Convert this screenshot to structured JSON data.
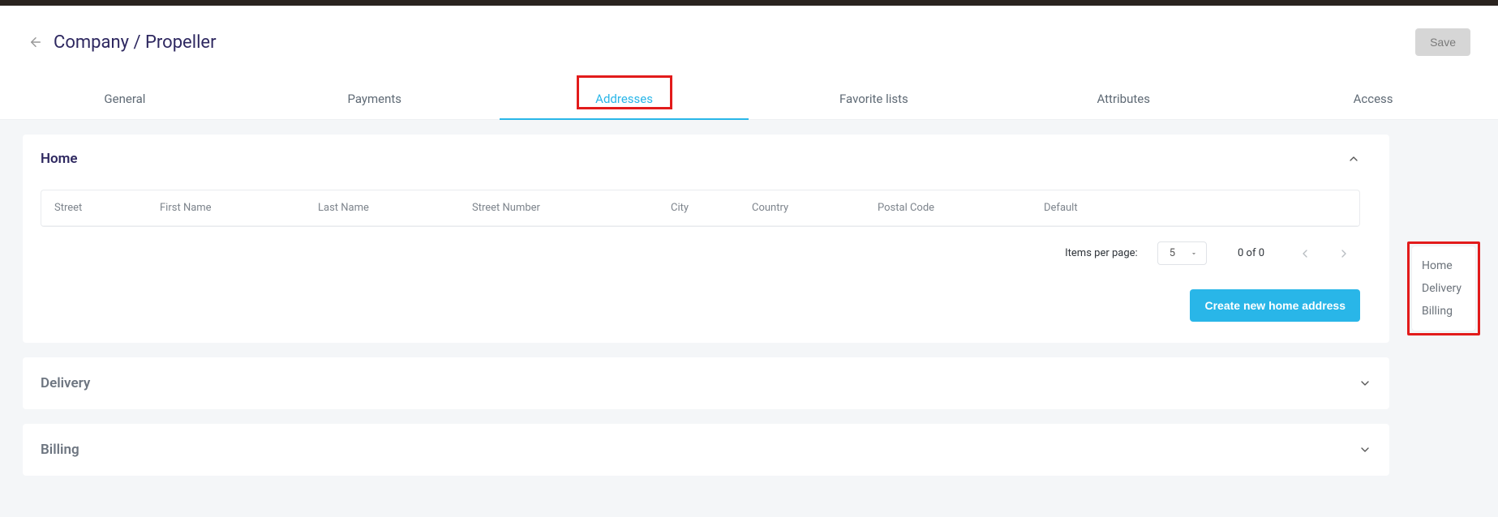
{
  "header": {
    "title": "Company / Propeller",
    "save_label": "Save"
  },
  "tabs": [
    {
      "label": "General"
    },
    {
      "label": "Payments"
    },
    {
      "label": "Addresses"
    },
    {
      "label": "Favorite lists"
    },
    {
      "label": "Attributes"
    },
    {
      "label": "Access"
    }
  ],
  "sideNav": {
    "items": [
      {
        "label": "Home"
      },
      {
        "label": "Delivery"
      },
      {
        "label": "Billing"
      }
    ]
  },
  "sections": {
    "home": {
      "title": "Home",
      "columns": {
        "street": "Street",
        "first_name": "First Name",
        "last_name": "Last Name",
        "street_number": "Street Number",
        "city": "City",
        "country": "Country",
        "postal_code": "Postal Code",
        "default": "Default"
      },
      "pagination": {
        "items_per_page_label": "Items per page:",
        "items_per_page_value": "5",
        "range_text": "0 of 0"
      },
      "create_button_label": "Create new home address"
    },
    "delivery": {
      "title": "Delivery"
    },
    "billing": {
      "title": "Billing"
    }
  }
}
